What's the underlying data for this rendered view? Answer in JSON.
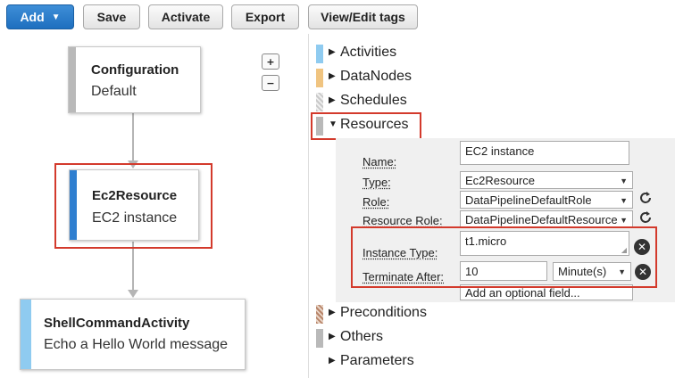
{
  "toolbar": {
    "add_label": "Add",
    "save_label": "Save",
    "activate_label": "Activate",
    "export_label": "Export",
    "tags_label": "View/Edit tags"
  },
  "canvas": {
    "zoom_in": "+",
    "zoom_out": "−",
    "nodes": [
      {
        "title": "Configuration",
        "subtitle": "Default",
        "bar_color": "#b9b9b9"
      },
      {
        "title": "Ec2Resource",
        "subtitle": "EC2 instance",
        "bar_color": "#2f7fd0"
      },
      {
        "title": "ShellCommandActivity",
        "subtitle": "Echo a Hello World message",
        "bar_color": "#8fcbf0"
      }
    ]
  },
  "panel": {
    "sections": [
      {
        "label": "Activities",
        "swatch": "#8fcbf0",
        "expanded": false
      },
      {
        "label": "DataNodes",
        "swatch": "#f0c480",
        "expanded": false
      },
      {
        "label": "Schedules",
        "swatch": "hatched-gray",
        "expanded": false
      },
      {
        "label": "Resources",
        "swatch": "#b9b9b9",
        "expanded": true
      },
      {
        "label": "Preconditions",
        "swatch": "hatched-brown",
        "expanded": false
      },
      {
        "label": "Others",
        "swatch": "#b9b9b9",
        "expanded": false
      },
      {
        "label": "Parameters",
        "swatch": "none",
        "expanded": false
      }
    ],
    "resource_form": {
      "name_label": "Name:",
      "name_value": "EC2 instance",
      "type_label": "Type:",
      "type_value": "Ec2Resource",
      "role_label": "Role:",
      "role_value": "DataPipelineDefaultRole",
      "resource_role_label": "Resource Role:",
      "resource_role_value": "DataPipelineDefaultResource",
      "instance_type_label": "Instance Type:",
      "instance_type_value": "t1.micro",
      "terminate_after_label": "Terminate After:",
      "terminate_after_value": "10",
      "terminate_after_unit": "Minute(s)",
      "optional_field_placeholder": "Add an optional field..."
    }
  },
  "colors": {
    "primary_button": "#1e6fbf",
    "highlight_red": "#d33a2c"
  }
}
